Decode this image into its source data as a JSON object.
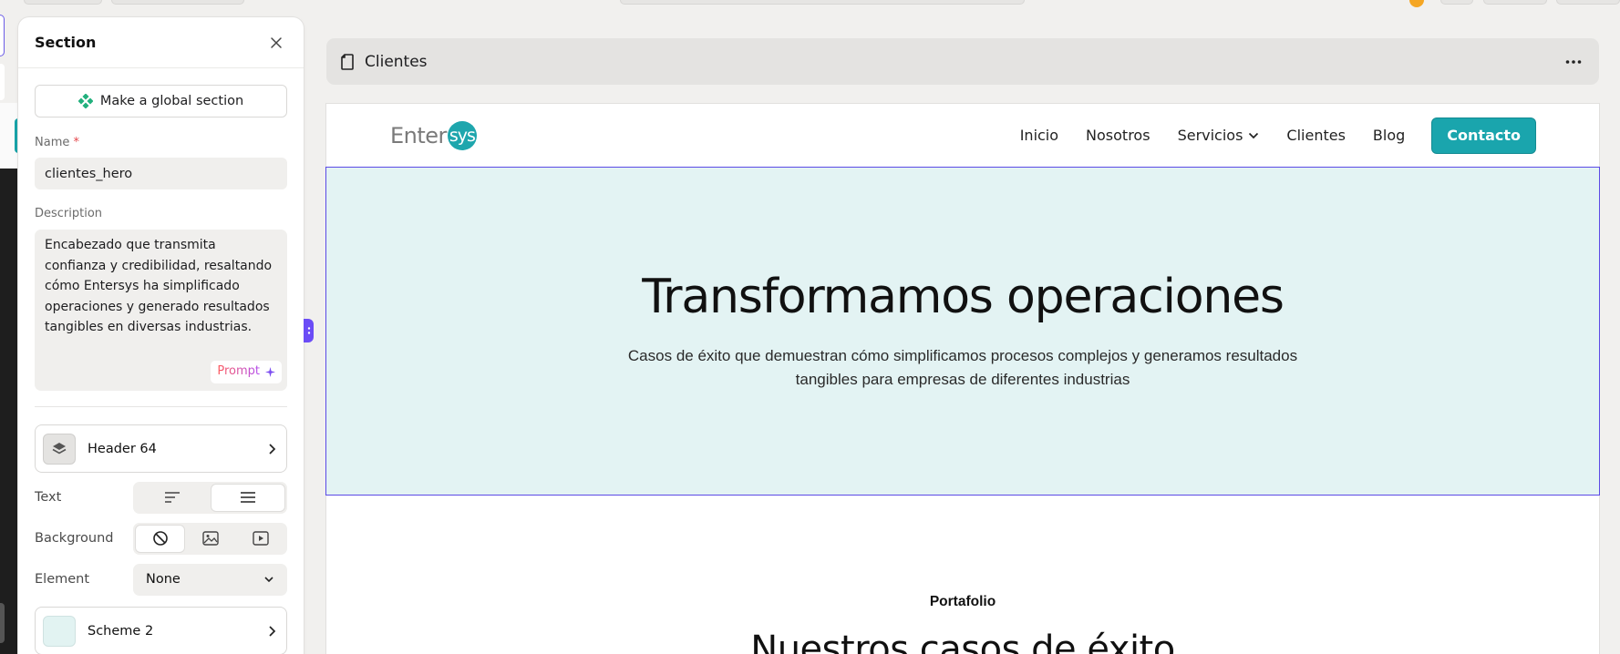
{
  "panel": {
    "title": "Section",
    "global_button": "Make a global section",
    "name_label": "Name",
    "required_mark": "*",
    "name_value": "clientes_hero",
    "description_label": "Description",
    "description_value": "Encabezado que transmita confianza y credibilidad, resaltando cómo Entersys ha simplificado operaciones y generado resultados tangibles en diversas industrias.",
    "prompt_label": "Prompt",
    "component": "Header 64",
    "text_label": "Text",
    "text_alignment": "center",
    "background_label": "Background",
    "background_selected": "none",
    "element_label": "Element",
    "element_value": "None",
    "scheme": "Scheme 2",
    "scheme_color": "#e2f3f2"
  },
  "page": {
    "title": "Clientes"
  },
  "site": {
    "logo_text": "Enter",
    "logo_badge": "sys",
    "nav": [
      "Inicio",
      "Nosotros",
      "Servicios",
      "Clientes",
      "Blog"
    ],
    "cta": "Contacto",
    "brand_color": "#1aa5ad"
  },
  "hero": {
    "title": "Transformamos operaciones",
    "subtitle": "Casos de éxito que demuestran cómo simplificamos procesos complejos y generamos resultados tangibles para empresas de diferentes industrias",
    "background": "#e3f3f3"
  },
  "portfolio": {
    "tag": "Portafolio",
    "title": "Nuestros casos de éxito"
  }
}
